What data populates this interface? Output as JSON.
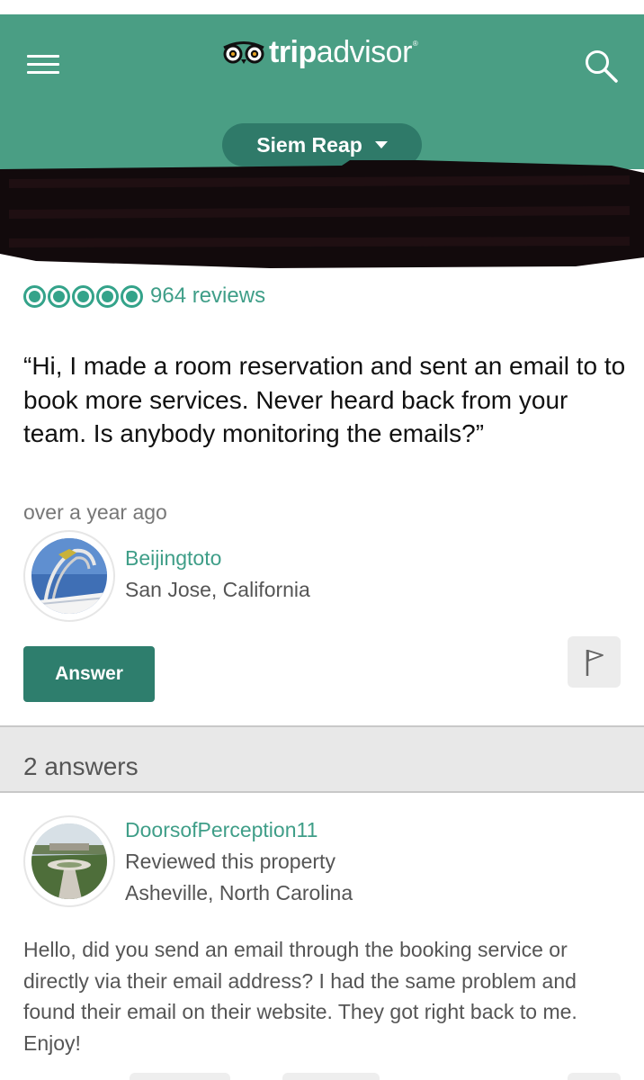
{
  "header": {
    "logo_text_bold": "trip",
    "logo_text_regular": "advisor",
    "logo_reg_mark": "®",
    "location": "Siem Reap",
    "bg_color": "#4a9e84",
    "pill_color": "#2f7a69",
    "icons": [
      "menu-icon",
      "owl-logo-icon",
      "search-icon",
      "chevron-down-icon"
    ]
  },
  "hotel": {
    "bubble_rating": 5,
    "reviews": "964 reviews"
  },
  "question": {
    "text": "“Hi, I made a room reservation and sent an email to to book more services. Never heard back from your team. Is anybody monitoring the emails?”",
    "time": "over a year ago",
    "asker": {
      "name": "Beijingtoto",
      "location": "San Jose, California"
    },
    "answer_button": "Answer",
    "icons": [
      "flag-icon"
    ]
  },
  "answers": {
    "count_label": "2 answers",
    "items": [
      {
        "name": "DoorsofPerception11",
        "note": "Reviewed this property",
        "location": "Asheville, North Carolina",
        "text": "Hello, did you send an email through the booking service or directly via their email address? I had the same problem and found their email on their website. They got right back to me. Enjoy!"
      }
    ]
  },
  "colors": {
    "accent_green": "#34a38a",
    "link_green": "#3f9e88",
    "button_green": "#2e7e6d"
  }
}
